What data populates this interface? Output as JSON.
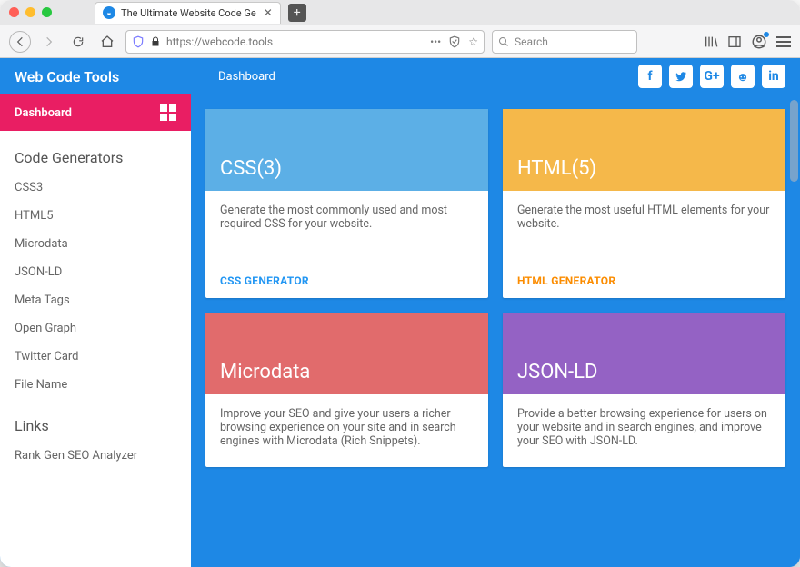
{
  "browser": {
    "tab_title": "The Ultimate Website Code Ge",
    "url_display": "https://webcode.tools",
    "search_placeholder": "Search"
  },
  "header": {
    "brand": "Web Code Tools",
    "breadcrumb": "Dashboard"
  },
  "sidebar": {
    "active": {
      "label": "Dashboard"
    },
    "section_generators": "Code Generators",
    "items": [
      {
        "label": "CSS3"
      },
      {
        "label": "HTML5"
      },
      {
        "label": "Microdata"
      },
      {
        "label": "JSON-LD"
      },
      {
        "label": "Meta Tags"
      },
      {
        "label": "Open Graph"
      },
      {
        "label": "Twitter Card"
      },
      {
        "label": "File Name"
      }
    ],
    "section_links": "Links",
    "links": [
      {
        "label": "Rank Gen SEO Analyzer"
      }
    ]
  },
  "cards": [
    {
      "title": "CSS(3)",
      "description": "Generate the most commonly used and most required CSS for your website.",
      "action": "CSS GENERATOR",
      "class": "c-blue"
    },
    {
      "title": "HTML(5)",
      "description": "Generate the most useful HTML elements for your website.",
      "action": "HTML GENERATOR",
      "class": "c-orange"
    },
    {
      "title": "Microdata",
      "description": "Improve your SEO and give your users a richer browsing experience on your site and in search engines with Microdata (Rich Snippets).",
      "action": "",
      "class": "c-red"
    },
    {
      "title": "JSON-LD",
      "description": "Provide a better browsing experience for users on your website and in search engines, and improve your SEO with JSON-LD.",
      "action": "",
      "class": "c-purple"
    }
  ]
}
